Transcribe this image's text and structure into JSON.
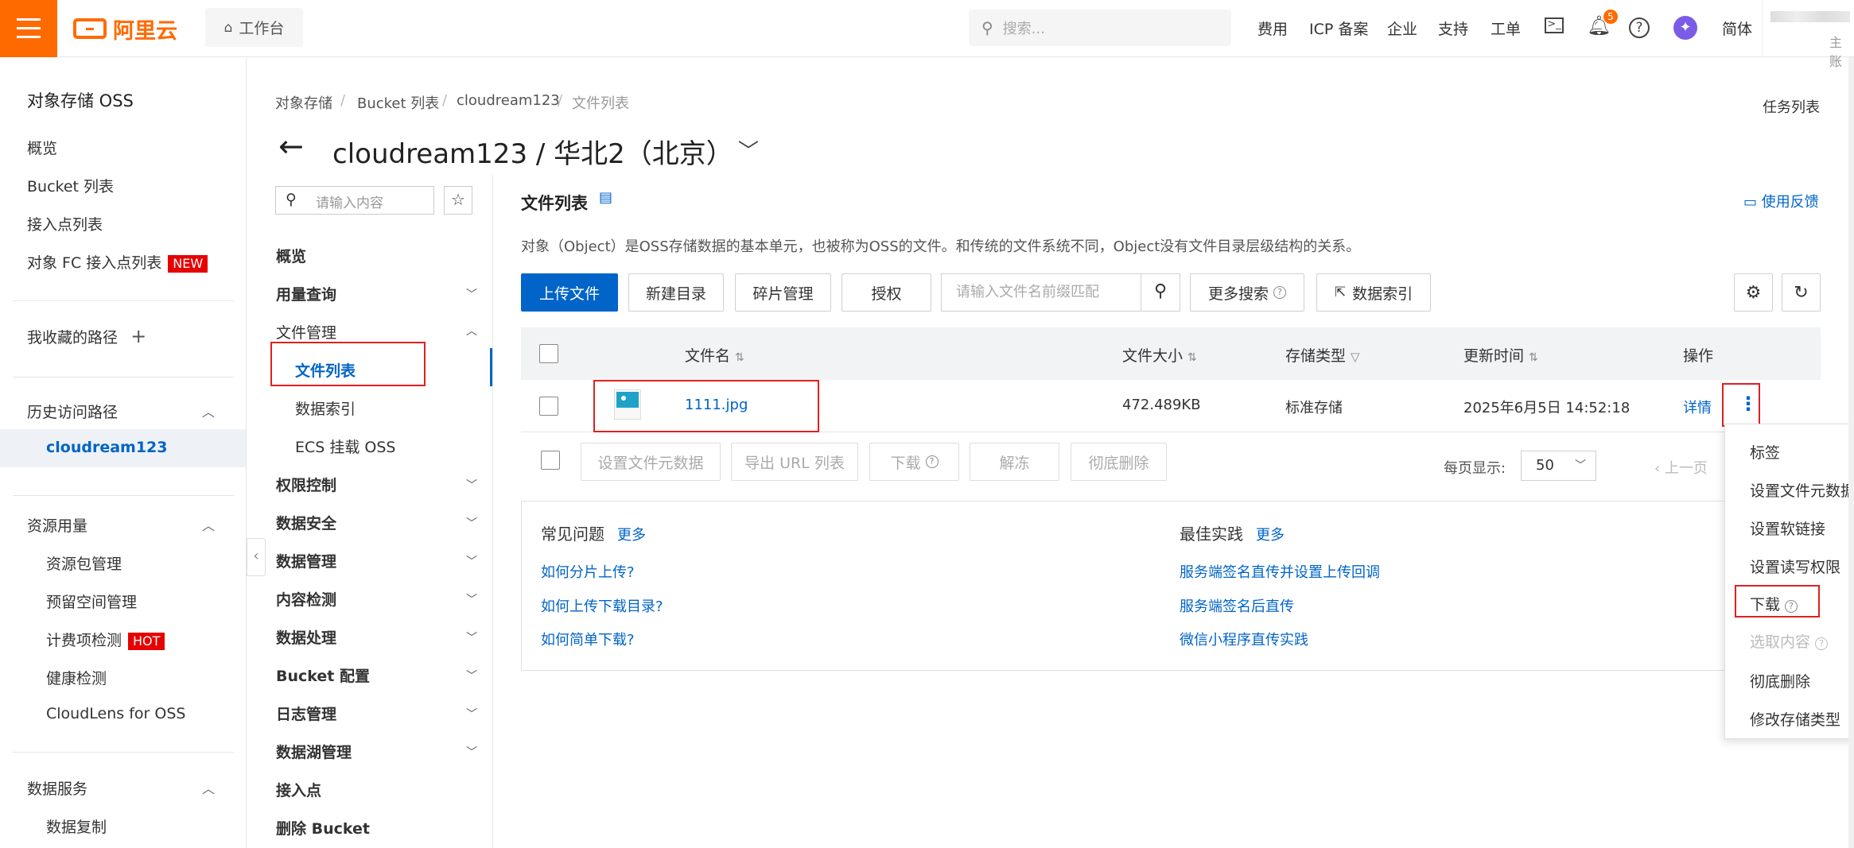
{
  "topbar": {
    "logo_text": "阿里云",
    "workbench": "工作台",
    "search_placeholder": "搜索...",
    "links": [
      "费用",
      "ICP 备案",
      "企业",
      "支持",
      "工单"
    ],
    "notification_count": "5",
    "language": "简体",
    "account_sub": "主账"
  },
  "sidebar": {
    "title": "对象存储 OSS",
    "items": [
      "概览",
      "Bucket 列表",
      "接入点列表"
    ],
    "fc_item": "对象 FC 接入点列表",
    "fc_badge": "NEW",
    "favorites": "我收藏的路径",
    "history": "历史访问路径",
    "history_item": "cloudream123",
    "resource": "资源用量",
    "resource_items": [
      "资源包管理",
      "预留空间管理"
    ],
    "billing_check": "计费项检测",
    "billing_badge": "HOT",
    "resource_items2": [
      "健康检测",
      "CloudLens for OSS"
    ],
    "data_service": "数据服务",
    "data_copy": "数据复制"
  },
  "subnav": {
    "search_placeholder": "请输入内容",
    "overview": "概览",
    "usage": "用量查询",
    "file_mgmt": "文件管理",
    "file_list": "文件列表",
    "data_index": "数据索引",
    "ecs_mount": "ECS 挂载 OSS",
    "groups": [
      "权限控制",
      "数据安全",
      "数据管理",
      "内容检测",
      "数据处理",
      "Bucket 配置",
      "日志管理",
      "数据湖管理"
    ],
    "access_point": "接入点",
    "delete_bucket": "删除 Bucket"
  },
  "breadcrumb": [
    "对象存储",
    "Bucket 列表",
    "cloudream123",
    "文件列表"
  ],
  "page_title": "cloudream123 / 华北2（北京）",
  "task_list": "任务列表",
  "feedback": "使用反馈",
  "section_title": "文件列表",
  "description": "对象（Object）是OSS存储数据的基本单元，也被称为OSS的文件。和传统的文件系统不同，Object没有文件目录层级结构的关系。",
  "toolbar": {
    "upload": "上传文件",
    "new_dir": "新建目录",
    "fragments": "碎片管理",
    "authorize": "授权",
    "search_placeholder": "请输入文件名前缀匹配",
    "more_search": "更多搜索",
    "data_index": "数据索引"
  },
  "table": {
    "headers": [
      "文件名",
      "文件大小",
      "存储类型",
      "更新时间",
      "操作"
    ],
    "row": {
      "name": "1111.jpg",
      "size": "472.489KB",
      "storage": "标准存储",
      "updated": "2025年6月5日 14:52:18",
      "detail": "详情"
    }
  },
  "bulk_actions": [
    "设置文件元数据",
    "导出 URL 列表",
    "下载",
    "解冻",
    "彻底删除"
  ],
  "pagination": {
    "label": "每页显示:",
    "size": "50",
    "prev": "上一页"
  },
  "faq": {
    "title": "常见问题",
    "more": "更多",
    "links": [
      "如何分片上传?",
      "如何上传下载目录?",
      "如何简单下载?"
    ]
  },
  "best": {
    "title": "最佳实践",
    "more": "更多",
    "links": [
      "服务端签名直传并设置上传回调",
      "服务端签名后直传",
      "微信小程序直传实践"
    ]
  },
  "dropdown": {
    "items": [
      "标签",
      "设置文件元数据",
      "设置软链接",
      "设置读写权限"
    ],
    "download": "下载",
    "select_content": "选取内容",
    "items2": [
      "彻底删除",
      "修改存储类型"
    ]
  },
  "colors": {
    "brand": "#ff6a00",
    "primary": "#0064c8",
    "highlight": "#e02020"
  }
}
